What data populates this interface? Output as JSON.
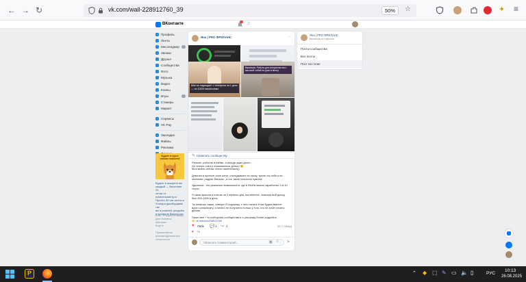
{
  "browser": {
    "url": "vk.com/wall-228912760_39",
    "zoom": "50%"
  },
  "vk_header": {
    "logo": "ВКонтакте"
  },
  "sidebar": {
    "items": [
      "Профиль",
      "Лента",
      "Мессенджер",
      "Звонки",
      "Друзья",
      "Сообщества",
      "Фото",
      "Музыка",
      "Видео",
      "Клипы",
      "Игры",
      "Стикеры",
      "Маркет"
    ],
    "items2": [
      "Сервисы",
      "VK Pay"
    ],
    "items3": [
      "Закладки",
      "Файлы",
      "Реклама",
      "Помощь"
    ],
    "ad_caption": [
      "Будьте в курсе",
      "свежих новостей"
    ],
    "ad_lines": [
      "Будьте в аккаунте вы",
      "каждый — Весенние 20",
      "сетов от",
      "mAdvedusterry.ru",
      "Прочёл 30 чат-ганты и",
      "Угонара дашбордами так",
      "вы в рогачёй, рекдьём",
      "в профиль Ввыстроко"
    ],
    "footer_lines": [
      "Блог · Разработчикам",
      "Для бизнеса · Авторам",
      "Ещё ▾"
    ],
    "footer_lines2": [
      "Применяется",
      "рекомендательные",
      "технологии"
    ]
  },
  "post": {
    "author": "Яна | PRO ФРИЛАНС",
    "collage_caption": "Мне не надоедает с телефона на 1 день — по 10000 вакансиями",
    "collage_caption2": "Вакансия: Работа для специалистов с высокой собой на рука в вечер",
    "write_to_community": "Написать сообществу",
    "body": [
      "Раньше, работая в найме, я иногда ждал долго...",
      "Но теперь я могу отказываться деньги 😊",
      "Моя жизнь сейчас очень изменилась))",
      "",
      "Девочки в проекте тоже котят, откладывают на пачку, тратят на себя и на",
      "экономят, радуют близких...а это такое классное чувство",
      "",
      "Удаленка - это реальные возможности, где в 28чём можно заработать 3-8-10",
      "тысяч",
      "",
      "Я сама пришла в итогом на 0 первого дня, постепенно, знакомя мой доход",
      "был 300-1000 в день",
      "",
      "Ты можешь также, поверь! Я подскажу, с чего начать и мы будем вместе",
      "идти к результату, а ничего не получится только у того, кто не хочет ничего",
      "делать",
      "",
      "Пиши мне + в сообщения сообщества и я расскажу более подробно",
      "👉 vk.me/club228912760"
    ],
    "like_count": "Лайк",
    "comment_count": "1",
    "share_count": "1",
    "time": "10 с назад",
    "views": "76",
    "comment_placeholder": "Написать комментарий..."
  },
  "right_panel": {
    "group_name": "Яна | PRO ФРИЛАНС",
    "group_sub": "вакансия в стартапе",
    "tabs": [
      "Посты сообщества",
      "Все посты",
      "Пост на стене"
    ]
  },
  "taskbar": {
    "lang": "РУС",
    "time": "10:13",
    "date": "26.08.2025"
  }
}
